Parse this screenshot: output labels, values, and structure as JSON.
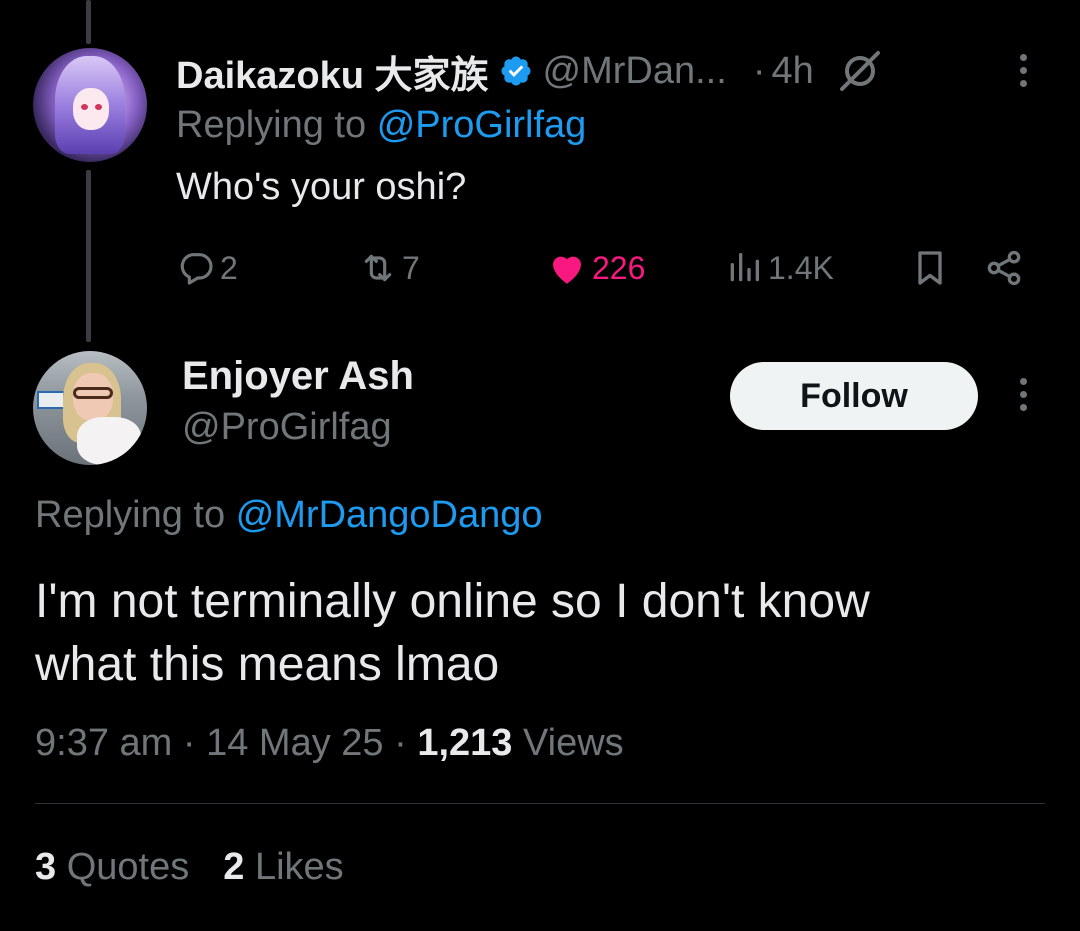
{
  "colors": {
    "background": "#000000",
    "text_primary": "#e7e9ea",
    "text_secondary": "#71767b",
    "link": "#1d9bf0",
    "like": "#f91880",
    "verified": "#1d9bf0",
    "follow_button_bg": "#eff3f4"
  },
  "parent_tweet": {
    "display_name": "Daikazoku 大家族",
    "verified_icon": "verified-badge-icon",
    "handle": "@MrDan...",
    "dot": "·",
    "time": "4h",
    "grok_icon": "grok-icon",
    "replying_prefix": "Replying to",
    "replying_to": "@ProGirlfag",
    "text": "Who's your oshi?",
    "actions": {
      "replies": "2",
      "retweets": "7",
      "likes": "226",
      "views": "1.4K"
    }
  },
  "main_tweet": {
    "display_name": "Enjoyer Ash",
    "handle": "@ProGirlfag",
    "follow_label": "Follow",
    "replying_prefix": "Replying to",
    "replying_to": "@MrDangoDango",
    "text_lines": [
      "I'm not terminally online so I don't know",
      "what this means lmao"
    ],
    "time": "9:37 am",
    "dot": "·",
    "date": "14 May 25",
    "views_count": "1,213",
    "views_label": "Views",
    "quotes_count": "3",
    "quotes_label": "Quotes",
    "likes_count": "2",
    "likes_label": "Likes"
  }
}
